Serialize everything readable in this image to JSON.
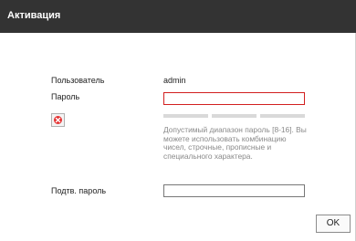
{
  "dialog": {
    "title": "Активация"
  },
  "form": {
    "user_label": "Пользователь",
    "user_value": "admin",
    "password_label": "Пароль",
    "password_value": "",
    "confirm_label": "Подтв. пароль",
    "confirm_value": "",
    "hint": "Допустимый диапазон пароль [8-16]. Вы можете использовать комбинацию чисел, строчные, прописные и специального характера.",
    "error_icon": "error-x-icon",
    "strength_level": 0
  },
  "buttons": {
    "ok_label": "OK"
  },
  "colors": {
    "titlebar": "#333333",
    "error_border": "#d21f1f",
    "error_icon": "#e53535",
    "hint_text": "#8a8a8a",
    "strength_bar": "#d9d9d9"
  }
}
